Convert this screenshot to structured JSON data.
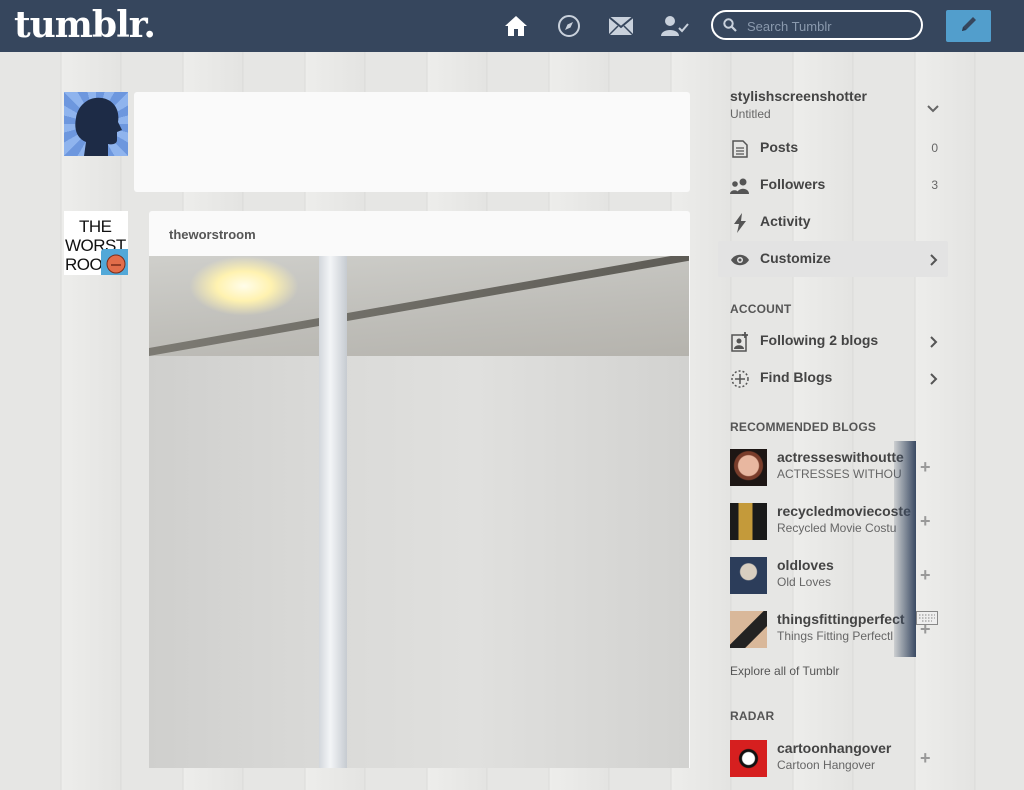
{
  "header": {
    "logo": "tumblr.",
    "search_placeholder": "Search Tumblr",
    "icons": [
      "home-icon",
      "explore-compass-icon",
      "inbox-envelope-icon",
      "account-user-icon"
    ],
    "compose_icon": "pencil-icon",
    "bg_color": "#36465d",
    "compose_color": "#529ecc"
  },
  "post": {
    "username": "theworstroom",
    "avatar_text_line1": "THE",
    "avatar_text_line2": "WORST",
    "avatar_text_line3": "ROO"
  },
  "sidebar": {
    "blog_name": "stylishscreenshotter",
    "blog_subtitle": "Untitled",
    "items": [
      {
        "label": "Posts",
        "count": "0",
        "icon": "posts-icon"
      },
      {
        "label": "Followers",
        "count": "3",
        "icon": "followers-icon"
      },
      {
        "label": "Activity",
        "count": "",
        "icon": "activity-icon"
      },
      {
        "label": "Customize",
        "count": "",
        "icon": "eye-icon"
      }
    ],
    "account_heading": "ACCOUNT",
    "account_items": [
      {
        "label": "Following 2 blogs",
        "icon": "following-icon"
      },
      {
        "label": "Find Blogs",
        "icon": "find-blogs-icon"
      }
    ],
    "recommended_heading": "RECOMMENDED BLOGS",
    "recommended": [
      {
        "name": "actresseswithoutte",
        "title": "ACTRESSES WITHOU"
      },
      {
        "name": "recycledmoviecoste",
        "title": "Recycled Movie Costu"
      },
      {
        "name": "oldloves",
        "title": "Old Loves"
      },
      {
        "name": "thingsfittingperfect",
        "title": "Things Fitting Perfectl"
      }
    ],
    "explore_link": "Explore all of Tumblr",
    "radar_heading": "RADAR",
    "radar": {
      "name": "cartoonhangover",
      "title": "Cartoon Hangover"
    }
  }
}
